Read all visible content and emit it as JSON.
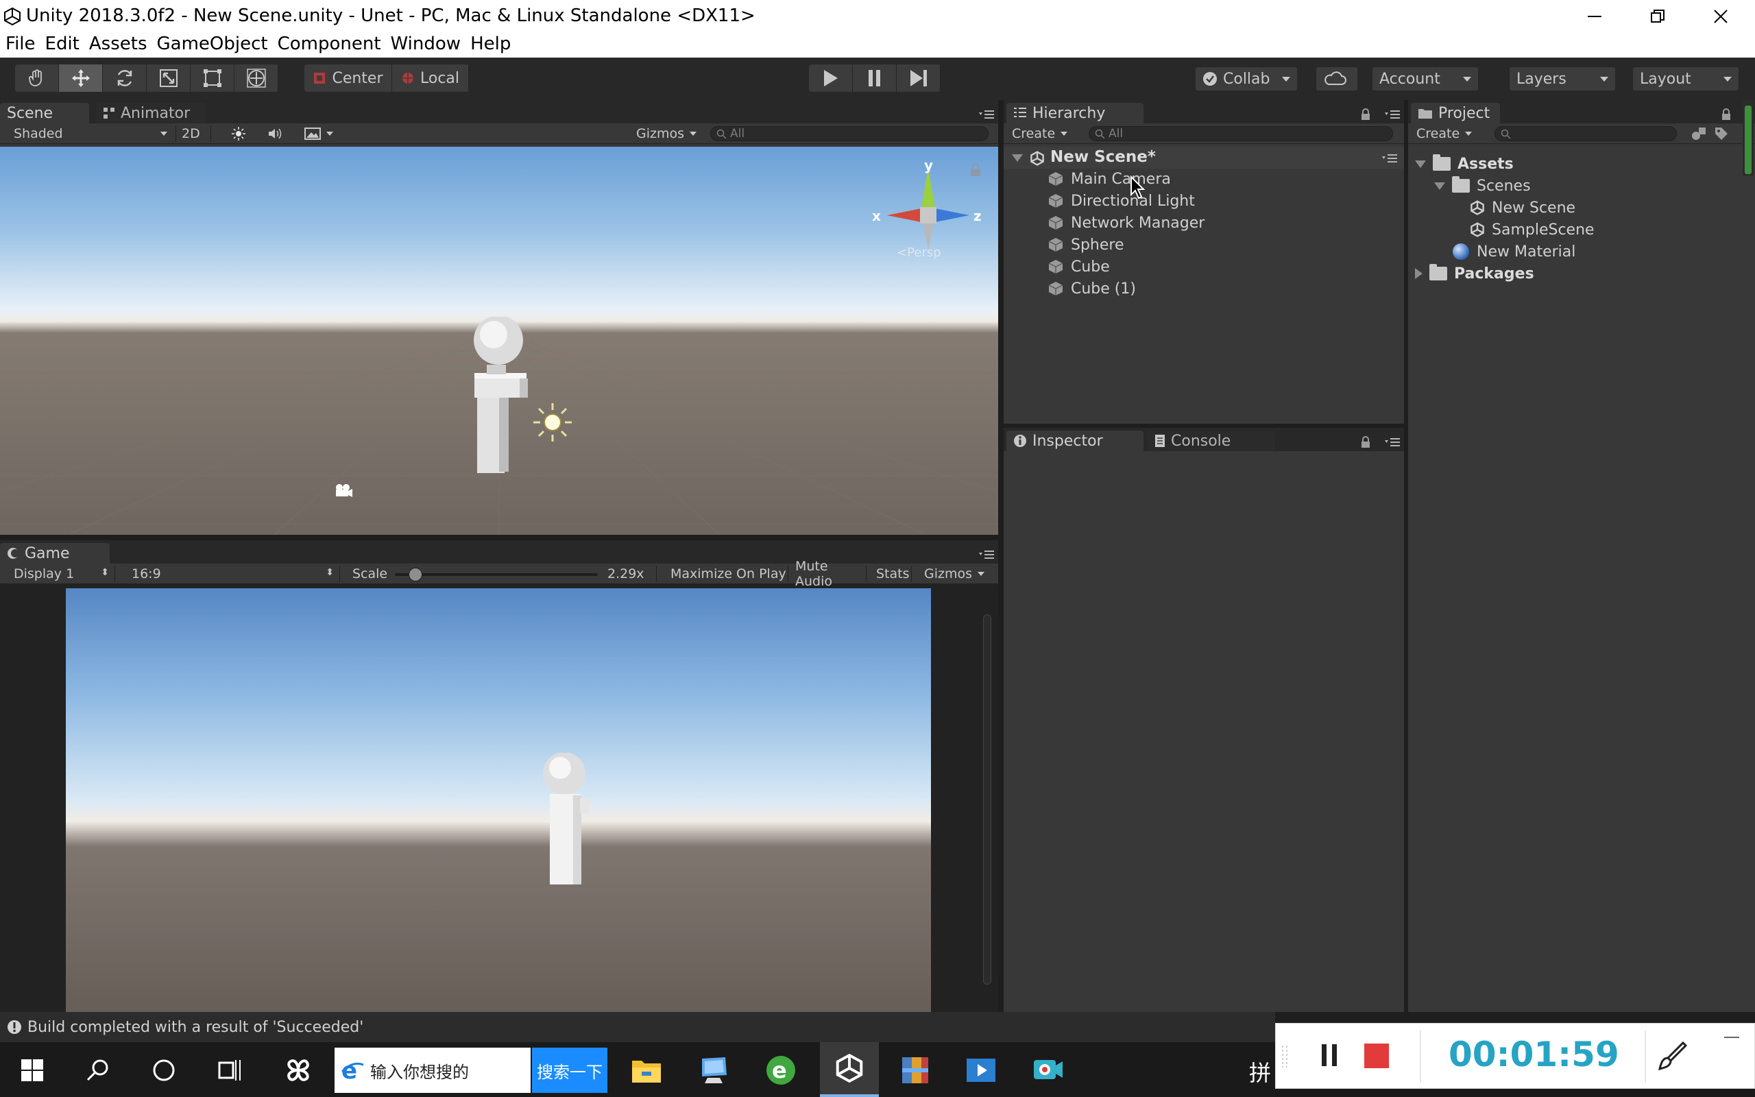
{
  "window": {
    "title": "Unity 2018.3.0f2 - New Scene.unity - Unet - PC, Mac & Linux Standalone <DX11>"
  },
  "menu": [
    "File",
    "Edit",
    "Assets",
    "GameObject",
    "Component",
    "Window",
    "Help"
  ],
  "toolbar": {
    "pivot_center": "Center",
    "pivot_local": "Local",
    "collab": "Collab",
    "account": "Account",
    "layers": "Layers",
    "layout": "Layout"
  },
  "scene_panel": {
    "tabs": [
      "Scene",
      "Animator"
    ],
    "shading_mode": "Shaded",
    "mode_2d": "2D",
    "gizmos": "Gizmos",
    "search_placeholder": "All",
    "gizmo_axes": {
      "y": "y",
      "x": "x",
      "z": "z"
    },
    "persp_label": "<Persp"
  },
  "game_panel": {
    "tab": "Game",
    "display": "Display 1",
    "aspect": "16:9",
    "scale_label": "Scale",
    "scale_value": "2.29x",
    "maximize_on_play": "Maximize On Play",
    "mute_audio": "Mute Audio",
    "stats": "Stats",
    "gizmos": "Gizmos"
  },
  "hierarchy": {
    "tab": "Hierarchy",
    "create": "Create",
    "search_placeholder": "All",
    "scene_name": "New Scene*",
    "items": [
      "Main Camera",
      "Directional Light",
      "Network Manager",
      "Sphere",
      "Cube",
      "Cube (1)"
    ]
  },
  "inspector": {
    "tabs": [
      "Inspector",
      "Console"
    ]
  },
  "project": {
    "tab": "Project",
    "create": "Create",
    "assets_label": "Assets",
    "scenes_folder": "Scenes",
    "scenes": [
      "New Scene",
      "SampleScene"
    ],
    "material": "New Material",
    "packages_label": "Packages"
  },
  "status": {
    "message": "Build completed with a result of 'Succeeded'"
  },
  "taskbar": {
    "search_text": "输入你想搜的",
    "search_button": "搜索一下",
    "ime": "拼"
  },
  "recorder": {
    "elapsed": "00:01:59",
    "stop_color": "#e23b3b",
    "timer_color": "#27a3c4"
  },
  "colors": {
    "editor_bg": "#383838",
    "header_bg": "#282828",
    "x_axis": "#d24a3c",
    "y_axis": "#9bd03e",
    "z_axis": "#3b7ad8"
  }
}
